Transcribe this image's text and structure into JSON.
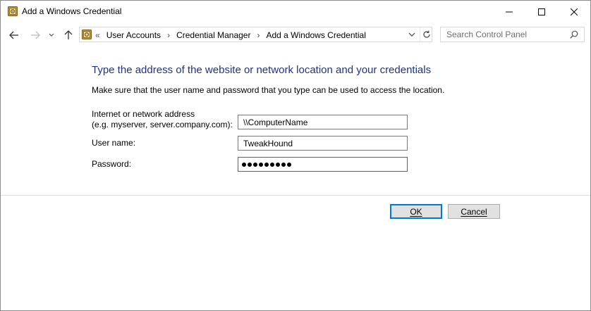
{
  "window": {
    "title": "Add a Windows Credential"
  },
  "nav": {
    "breadcrumb_prefix": "«",
    "breadcrumbs": [
      "User Accounts",
      "Credential Manager",
      "Add a Windows Credential"
    ],
    "separator": "›",
    "search_placeholder": "Search Control Panel"
  },
  "content": {
    "heading": "Type the address of the website or network location and your credentials",
    "instruction": "Make sure that the user name and password that you type can be used to access the location.",
    "address_label_line1": "Internet or network address",
    "address_label_line2": "(e.g. myserver, server.company.com):",
    "address_value": "\\\\ComputerName",
    "username_label": "User name:",
    "username_value": "TweakHound",
    "password_label": "Password:",
    "password_length": 9
  },
  "buttons": {
    "ok": "OK",
    "cancel": "Cancel"
  },
  "colors": {
    "heading": "#1e3287",
    "focus_border": "#0078d7"
  }
}
